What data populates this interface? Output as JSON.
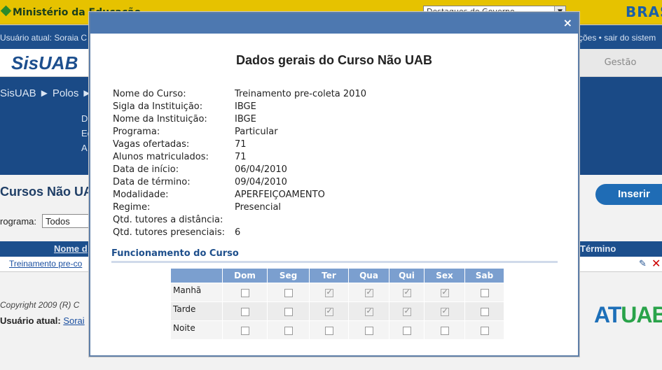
{
  "gov_bar": {
    "title": "Ministério da Educação",
    "select_value": "Destaques do Governo",
    "logo": "BRASIL"
  },
  "user_bar": {
    "left_text": "Usuário atual: Soraia C",
    "right_text": "ções • sair do sistem"
  },
  "logo_bar": {
    "logo": "SisUAB",
    "menu_gestao": "Gestão"
  },
  "breadcrumb": "SisUAB ► Polos ►",
  "blue_band_lines": [
    "D",
    "Ec",
    "A"
  ],
  "page": {
    "title": "Cursos Não UA",
    "insert_button": "Inserir",
    "program_label": "rograma:",
    "program_value": "Todos"
  },
  "table": {
    "col_nome": "Nome d",
    "col_termino": "Término",
    "row_link": "Treinamento pre-co"
  },
  "footer": {
    "copyright": "Copyright 2009 (R) C",
    "user_label": "Usuário atual:",
    "user_link": "Sorai",
    "logo_a": "AT",
    "logo_b": "UAB"
  },
  "modal": {
    "title": "Dados gerais do Curso Não UAB",
    "close": "×",
    "details": [
      {
        "label": "Nome do Curso:",
        "value": "Treinamento pre-coleta 2010"
      },
      {
        "label": "Sigla da Instituição:",
        "value": "IBGE"
      },
      {
        "label": "Nome da Instituição:",
        "value": "IBGE"
      },
      {
        "label": "Programa:",
        "value": "Particular"
      },
      {
        "label": "Vagas ofertadas:",
        "value": "71"
      },
      {
        "label": "Alunos matriculados:",
        "value": "71"
      },
      {
        "label": "Data de início:",
        "value": "06/04/2010"
      },
      {
        "label": "Data de término:",
        "value": "09/04/2010"
      },
      {
        "label": "Modalidade:",
        "value": "APERFEIÇOAMENTO"
      },
      {
        "label": "Regime:",
        "value": "Presencial"
      },
      {
        "label": "Qtd. tutores a distância:",
        "value": ""
      },
      {
        "label": "Qtd. tutores presenciais:",
        "value": "6"
      }
    ],
    "section_title": "Funcionamento do Curso",
    "schedule": {
      "days": [
        "Dom",
        "Seg",
        "Ter",
        "Qua",
        "Qui",
        "Sex",
        "Sab"
      ],
      "periods": [
        {
          "name": "Manhã",
          "checked": [
            false,
            false,
            true,
            true,
            true,
            true,
            false
          ]
        },
        {
          "name": "Tarde",
          "checked": [
            false,
            false,
            true,
            true,
            true,
            true,
            false
          ]
        },
        {
          "name": "Noite",
          "checked": [
            false,
            false,
            false,
            false,
            false,
            false,
            false
          ]
        }
      ]
    }
  }
}
